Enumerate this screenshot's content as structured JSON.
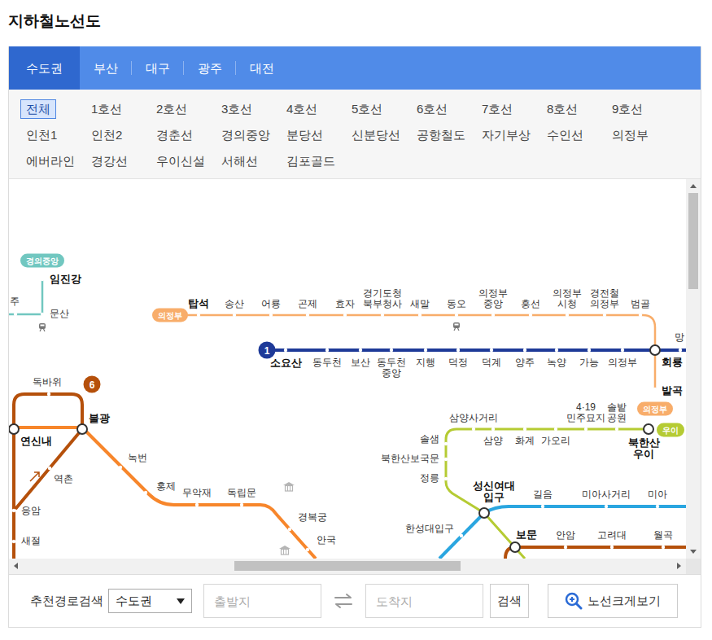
{
  "title": "지하철노선도",
  "regions": [
    {
      "label": "수도권",
      "selected": true
    },
    {
      "label": "부산",
      "selected": false
    },
    {
      "label": "대구",
      "selected": false
    },
    {
      "label": "광주",
      "selected": false
    },
    {
      "label": "대전",
      "selected": false
    }
  ],
  "line_filters": [
    {
      "label": "전체",
      "selected": true
    },
    {
      "label": "1호선",
      "selected": false
    },
    {
      "label": "2호선",
      "selected": false
    },
    {
      "label": "3호선",
      "selected": false
    },
    {
      "label": "4호선",
      "selected": false
    },
    {
      "label": "5호선",
      "selected": false
    },
    {
      "label": "6호선",
      "selected": false
    },
    {
      "label": "7호선",
      "selected": false
    },
    {
      "label": "8호선",
      "selected": false
    },
    {
      "label": "9호선",
      "selected": false
    },
    {
      "label": "인천1",
      "selected": false
    },
    {
      "label": "인천2",
      "selected": false
    },
    {
      "label": "경춘선",
      "selected": false
    },
    {
      "label": "경의중앙",
      "selected": false
    },
    {
      "label": "분당선",
      "selected": false
    },
    {
      "label": "신분당선",
      "selected": false
    },
    {
      "label": "공항철도",
      "selected": false
    },
    {
      "label": "자기부상",
      "selected": false
    },
    {
      "label": "수인선",
      "selected": false
    },
    {
      "label": "의정부",
      "selected": false
    },
    {
      "label": "에버라인",
      "selected": false
    },
    {
      "label": "경강선",
      "selected": false
    },
    {
      "label": "우이신설",
      "selected": false
    },
    {
      "label": "서해선",
      "selected": false
    },
    {
      "label": "김포골드",
      "selected": false
    }
  ],
  "map": {
    "lines": [
      {
        "color": "#71c7c0",
        "badges": [
          {
            "text": "경의중앙",
            "kind": "pill"
          }
        ],
        "stations": [
          {
            "name": "임진강",
            "emphasized": true,
            "transfer": false
          },
          {
            "name": "문산",
            "emphasized": false,
            "transfer": false
          },
          {
            "name": "주",
            "emphasized": false,
            "transfer": false
          }
        ]
      },
      {
        "color": "#f8ad6a",
        "badges": [
          {
            "text": "의정부",
            "kind": "pill"
          },
          {
            "text": "의정부",
            "kind": "pill"
          }
        ],
        "stations": [
          {
            "name": "탑석",
            "emphasized": true,
            "transfer": false
          },
          {
            "name": "송산",
            "emphasized": false,
            "transfer": false
          },
          {
            "name": "어룡",
            "emphasized": false,
            "transfer": false
          },
          {
            "name": "곤제",
            "emphasized": false,
            "transfer": false
          },
          {
            "name": "효자",
            "emphasized": false,
            "transfer": false
          },
          {
            "name": "경기도청\n북부청사",
            "emphasized": false,
            "transfer": false
          },
          {
            "name": "새말",
            "emphasized": false,
            "transfer": false
          },
          {
            "name": "동오",
            "emphasized": false,
            "transfer": false
          },
          {
            "name": "의정부\n중앙",
            "emphasized": false,
            "transfer": false
          },
          {
            "name": "흥선",
            "emphasized": false,
            "transfer": false
          },
          {
            "name": "의정부\n시청",
            "emphasized": false,
            "transfer": false
          },
          {
            "name": "경전철\n의정부",
            "emphasized": false,
            "transfer": false
          },
          {
            "name": "범골",
            "emphasized": false,
            "transfer": false
          },
          {
            "name": "발곡",
            "emphasized": true,
            "transfer": false
          }
        ]
      },
      {
        "color": "#1e3a98",
        "badges": [
          {
            "text": "1",
            "kind": "circle"
          }
        ],
        "stations": [
          {
            "name": "소요산",
            "emphasized": true,
            "transfer": false
          },
          {
            "name": "동두천",
            "emphasized": false,
            "transfer": false
          },
          {
            "name": "보산",
            "emphasized": false,
            "transfer": false
          },
          {
            "name": "동두천\n중앙",
            "emphasized": false,
            "transfer": false
          },
          {
            "name": "지행",
            "emphasized": false,
            "transfer": false
          },
          {
            "name": "덕정",
            "emphasized": false,
            "transfer": false
          },
          {
            "name": "덕계",
            "emphasized": false,
            "transfer": false
          },
          {
            "name": "양주",
            "emphasized": false,
            "transfer": false
          },
          {
            "name": "녹양",
            "emphasized": false,
            "transfer": false
          },
          {
            "name": "가능",
            "emphasized": false,
            "transfer": false
          },
          {
            "name": "의정부",
            "emphasized": false,
            "transfer": false
          },
          {
            "name": "회룡",
            "emphasized": true,
            "transfer": true
          },
          {
            "name": "망",
            "emphasized": false,
            "transfer": false
          }
        ]
      },
      {
        "color": "#b5500b",
        "badges": [
          {
            "text": "6",
            "kind": "circle"
          }
        ],
        "stations": [
          {
            "name": "연신내",
            "emphasized": true,
            "transfer": true
          },
          {
            "name": "독바위",
            "emphasized": false,
            "transfer": false
          },
          {
            "name": "불광",
            "emphasized": true,
            "transfer": true
          },
          {
            "name": "역촌",
            "emphasized": false,
            "transfer": false
          },
          {
            "name": "응암",
            "emphasized": false,
            "transfer": false
          },
          {
            "name": "새절",
            "emphasized": false,
            "transfer": false
          },
          {
            "name": "보문",
            "emphasized": true,
            "transfer": true
          },
          {
            "name": "안암",
            "emphasized": false,
            "transfer": false
          },
          {
            "name": "고려대",
            "emphasized": false,
            "transfer": false
          },
          {
            "name": "월곡",
            "emphasized": false,
            "transfer": false
          }
        ]
      },
      {
        "color": "#f7862b",
        "badges": [],
        "stations": [
          {
            "name": "녹번",
            "emphasized": false,
            "transfer": false
          },
          {
            "name": "홍제",
            "emphasized": false,
            "transfer": false
          },
          {
            "name": "무악재",
            "emphasized": false,
            "transfer": false
          },
          {
            "name": "독립문",
            "emphasized": false,
            "transfer": false
          },
          {
            "name": "경복궁",
            "emphasized": false,
            "transfer": false
          },
          {
            "name": "안국",
            "emphasized": false,
            "transfer": false
          }
        ]
      },
      {
        "color": "#b5cb33",
        "badges": [
          {
            "text": "우이",
            "kind": "pill"
          }
        ],
        "stations": [
          {
            "name": "삼양사거리",
            "emphasized": false,
            "transfer": false
          },
          {
            "name": "삼양",
            "emphasized": false,
            "transfer": false
          },
          {
            "name": "화계",
            "emphasized": false,
            "transfer": false
          },
          {
            "name": "가오리",
            "emphasized": false,
            "transfer": false
          },
          {
            "name": "4·19\n민주묘지",
            "emphasized": false,
            "transfer": false
          },
          {
            "name": "솔밭\n공원",
            "emphasized": false,
            "transfer": false
          },
          {
            "name": "북한산\n우이",
            "emphasized": true,
            "transfer": true
          },
          {
            "name": "솔샘",
            "emphasized": false,
            "transfer": false
          },
          {
            "name": "북한산보국문",
            "emphasized": false,
            "transfer": false
          },
          {
            "name": "정릉",
            "emphasized": false,
            "transfer": false
          },
          {
            "name": "성신여대\n입구",
            "emphasized": true,
            "transfer": true
          }
        ]
      },
      {
        "color": "#2aa6e0",
        "badges": [],
        "stations": [
          {
            "name": "한성대입구",
            "emphasized": false,
            "transfer": false
          },
          {
            "name": "길음",
            "emphasized": false,
            "transfer": false
          },
          {
            "name": "미아사거리",
            "emphasized": false,
            "transfer": false
          },
          {
            "name": "미아",
            "emphasized": false,
            "transfer": false
          }
        ]
      }
    ]
  },
  "scrollbars": {
    "vertical": {
      "level": 0
    },
    "horizontal": {
      "level": 0.5
    }
  },
  "route_search": {
    "label": "추천경로검색",
    "region": "수도권",
    "origin_placeholder": "출발지",
    "destination_placeholder": "도착지",
    "search_button": "검색",
    "enlarge_button": "노선크게보기"
  }
}
